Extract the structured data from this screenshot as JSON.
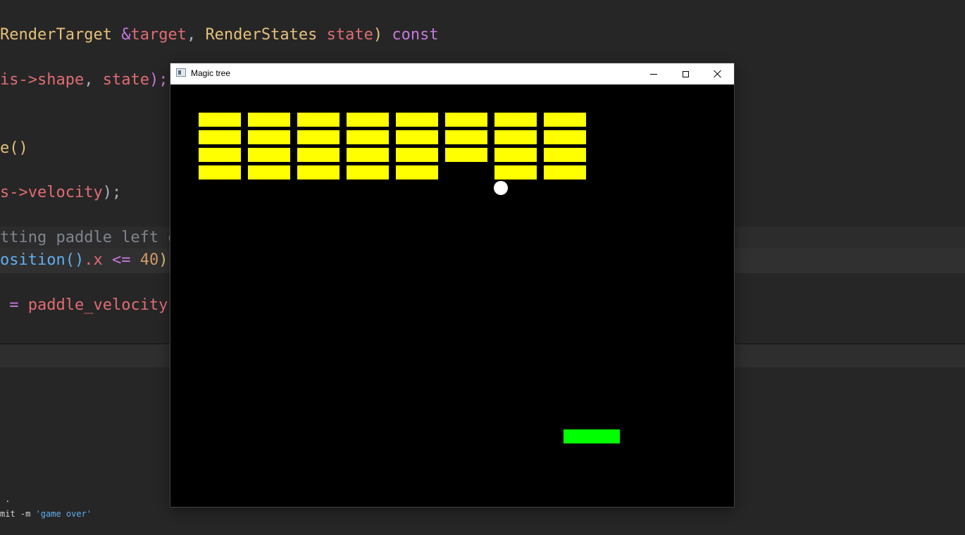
{
  "editor": {
    "lines": [
      {
        "tokens": [
          [
            "RenderTarget",
            "#e5c07b"
          ],
          [
            " ",
            "#abb2bf"
          ],
          [
            "&",
            "#c678dd"
          ],
          [
            "target",
            "#e06c75"
          ],
          [
            ", ",
            "#abb2bf"
          ],
          [
            "RenderStates",
            "#e5c07b"
          ],
          [
            " ",
            "#abb2bf"
          ],
          [
            "state",
            "#e06c75"
          ],
          [
            ") ",
            "#e5c07b"
          ],
          [
            "const",
            "#c678dd"
          ]
        ]
      },
      {
        "tokens": [
          [
            "is->",
            "#e06c75"
          ],
          [
            "shape",
            "#e06c75"
          ],
          [
            ", ",
            "#abb2bf"
          ],
          [
            "state",
            "#e06c75"
          ],
          [
            ");",
            "#c678dd"
          ]
        ]
      },
      {
        "tokens": [
          [
            "e",
            "#e5c07b"
          ],
          [
            "()",
            "#e5c07b"
          ]
        ]
      },
      {
        "tokens": [
          [
            "s->",
            "#e06c75"
          ],
          [
            "velocity",
            "#e06c75"
          ],
          [
            ");",
            "#abb2bf"
          ]
        ]
      },
      {
        "tokens": [
          [
            "tting paddle left o",
            "#7f848e"
          ]
        ]
      },
      {
        "tokens": [
          [
            "osition",
            "#61afef"
          ],
          [
            "()",
            "#61afef"
          ],
          [
            ".x ",
            "#e06c75"
          ],
          [
            "<=",
            "#c678dd"
          ],
          [
            " ",
            "#abb2bf"
          ],
          [
            "40",
            "#d19a66"
          ],
          [
            ")",
            "#e5c07b"
          ]
        ]
      },
      {
        "tokens": [
          [
            " = ",
            "#c678dd"
          ],
          [
            "paddle_velocity",
            "#e06c75"
          ],
          [
            ";",
            "#abb2bf"
          ]
        ]
      }
    ]
  },
  "terminal": {
    "lines": [
      {
        "tokens": [
          [
            " .",
            "#d4d4d4"
          ]
        ]
      },
      {
        "tokens": [
          [
            "mit -m ",
            "#d4d4d4"
          ],
          [
            "'game over'",
            "#61afef"
          ]
        ]
      }
    ]
  },
  "window": {
    "title": "Magic tree",
    "icon": "app-window-icon",
    "controls": {
      "minimize": "minimize-icon",
      "maximize": "maximize-icon",
      "close": "close-icon"
    }
  },
  "game": {
    "background": "#000000",
    "brick_color": "#ffff00",
    "ball_color": "#ffffff",
    "paddle_color": "#00ff00",
    "brick_grid": {
      "columns": 8,
      "rows": 4,
      "present": [
        [
          1,
          1,
          1,
          1,
          1,
          1,
          1,
          1
        ],
        [
          1,
          1,
          1,
          1,
          1,
          1,
          1,
          1
        ],
        [
          1,
          1,
          1,
          1,
          1,
          1,
          1,
          1
        ],
        [
          1,
          1,
          1,
          1,
          1,
          0,
          1,
          1
        ]
      ]
    }
  }
}
